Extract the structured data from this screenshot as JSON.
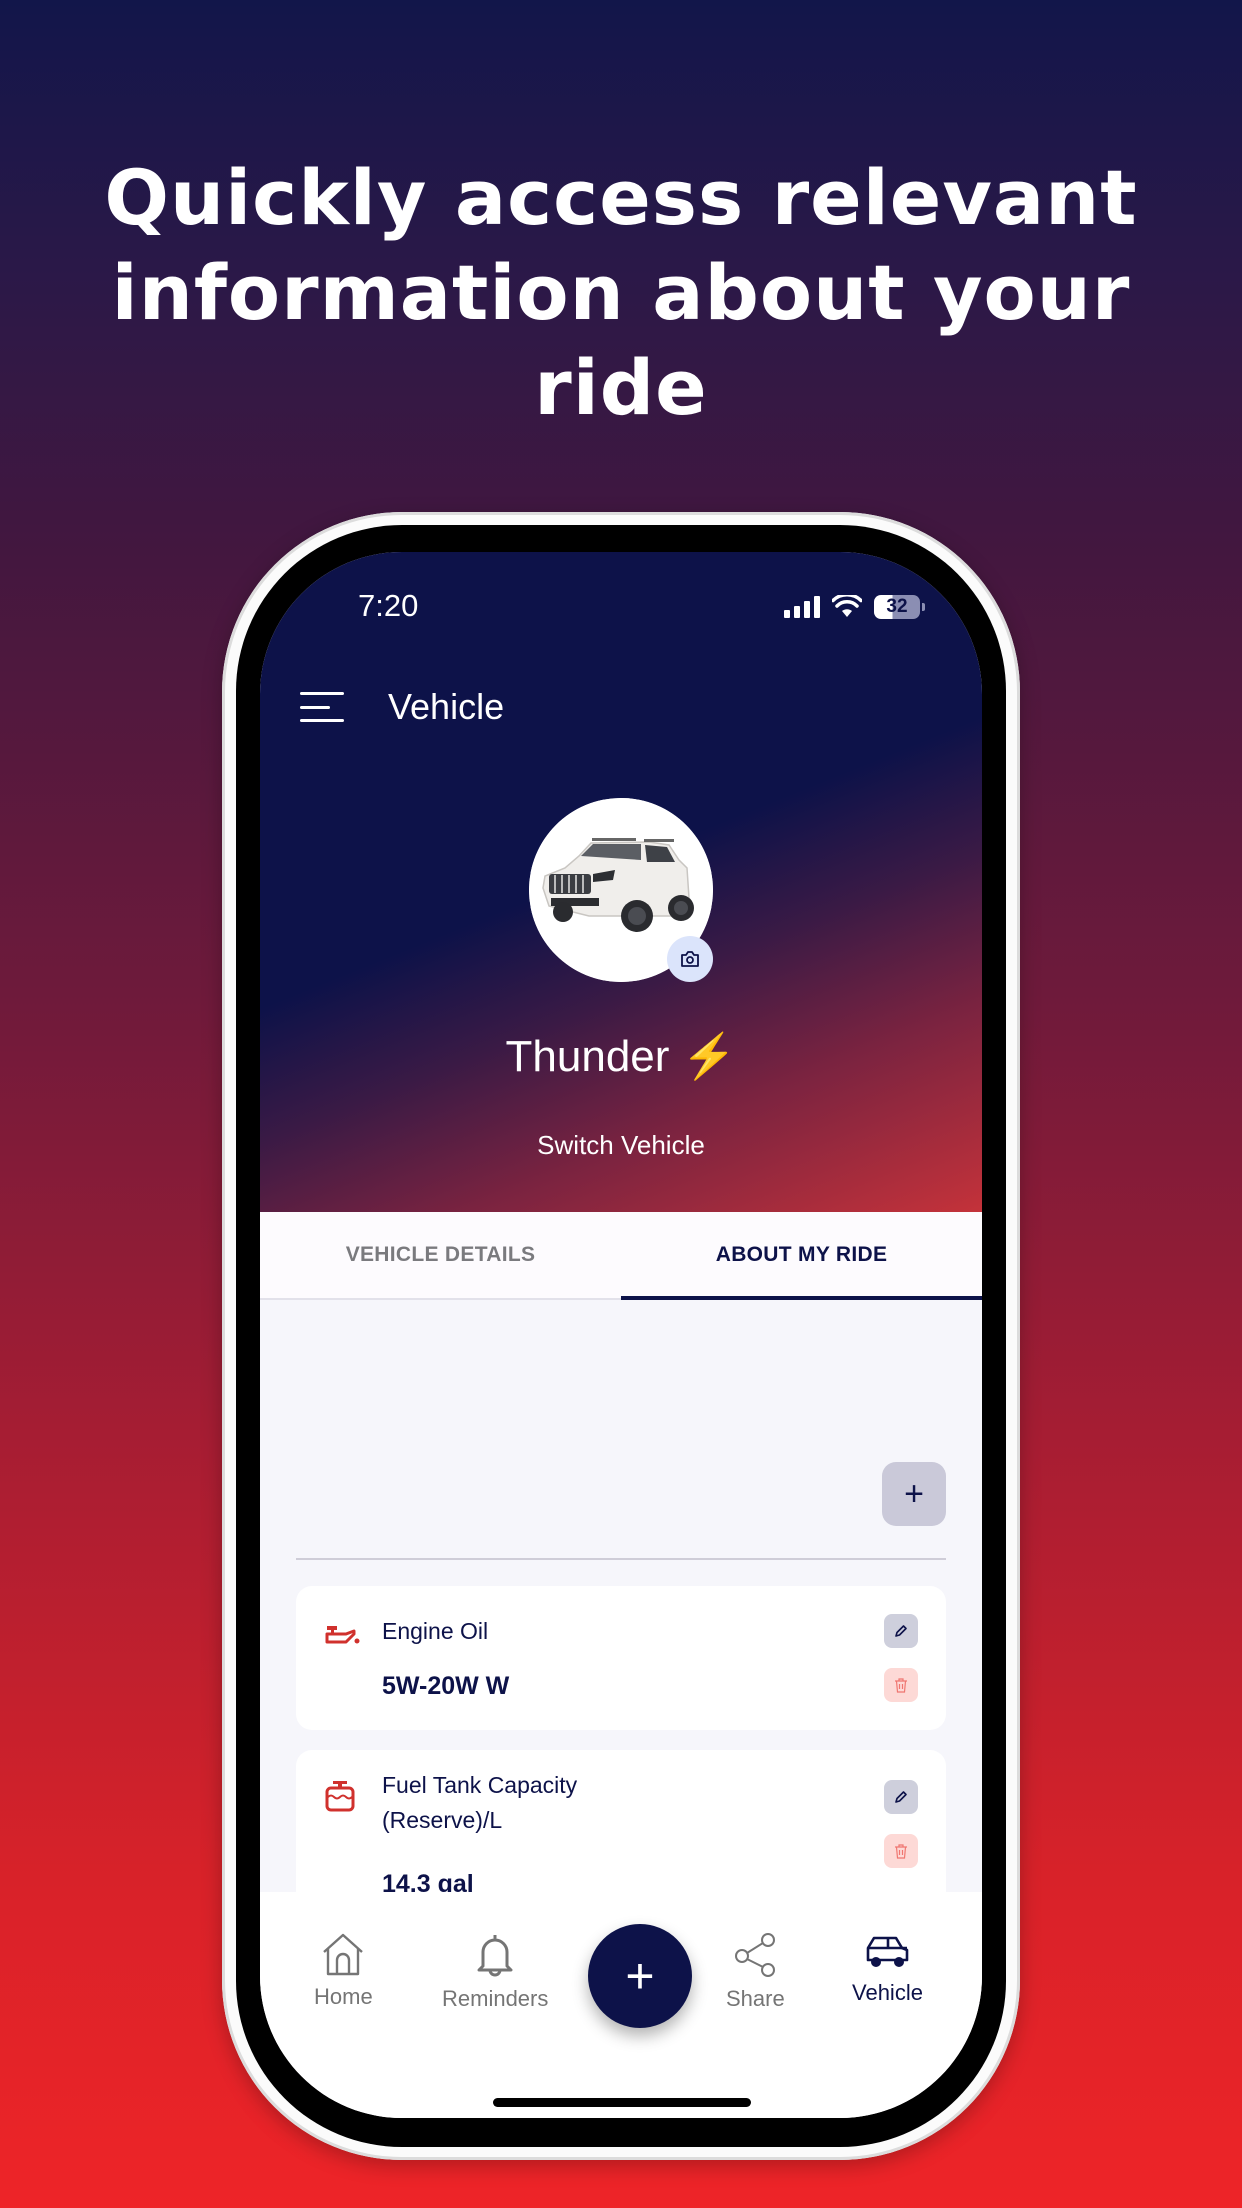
{
  "headline": {
    "line1": "Quickly access relevant",
    "line2": "information about your",
    "line3": "ride"
  },
  "status_bar": {
    "time": "7:20",
    "battery": "32"
  },
  "app_bar": {
    "title": "Vehicle",
    "menu_icon": "hamburger-menu-icon"
  },
  "vehicle": {
    "name": "Thunder",
    "emoji": "⚡",
    "switch_label": "Switch Vehicle",
    "photo_alt": "white SUV",
    "camera_icon": "camera-icon"
  },
  "tabs": [
    {
      "label": "VEHICLE DETAILS",
      "active": false
    },
    {
      "label": "ABOUT MY RIDE",
      "active": true
    }
  ],
  "add_button_label": "+",
  "items": [
    {
      "icon": "engine-oil-icon",
      "label_line1": "Engine Oil",
      "label_line2": "",
      "value": "5W-20W W"
    },
    {
      "icon": "fuel-tank-icon",
      "label_line1": "Fuel Tank Capacity",
      "label_line2": "(Reserve)/L",
      "value": "14.3 gal"
    }
  ],
  "bottom_nav": {
    "items": [
      {
        "label": "Home",
        "icon": "home-icon",
        "active": false
      },
      {
        "label": "Reminders",
        "icon": "bell-icon",
        "active": false
      },
      {
        "label": "Share",
        "icon": "share-icon",
        "active": false
      },
      {
        "label": "Vehicle",
        "icon": "car-icon",
        "active": true
      }
    ],
    "fab_label": "+"
  },
  "colors": {
    "primary": "#0d1249",
    "accent_red": "#d0312d",
    "delete_bg": "#fdd9d6",
    "edit_bg": "#cecfdc"
  }
}
